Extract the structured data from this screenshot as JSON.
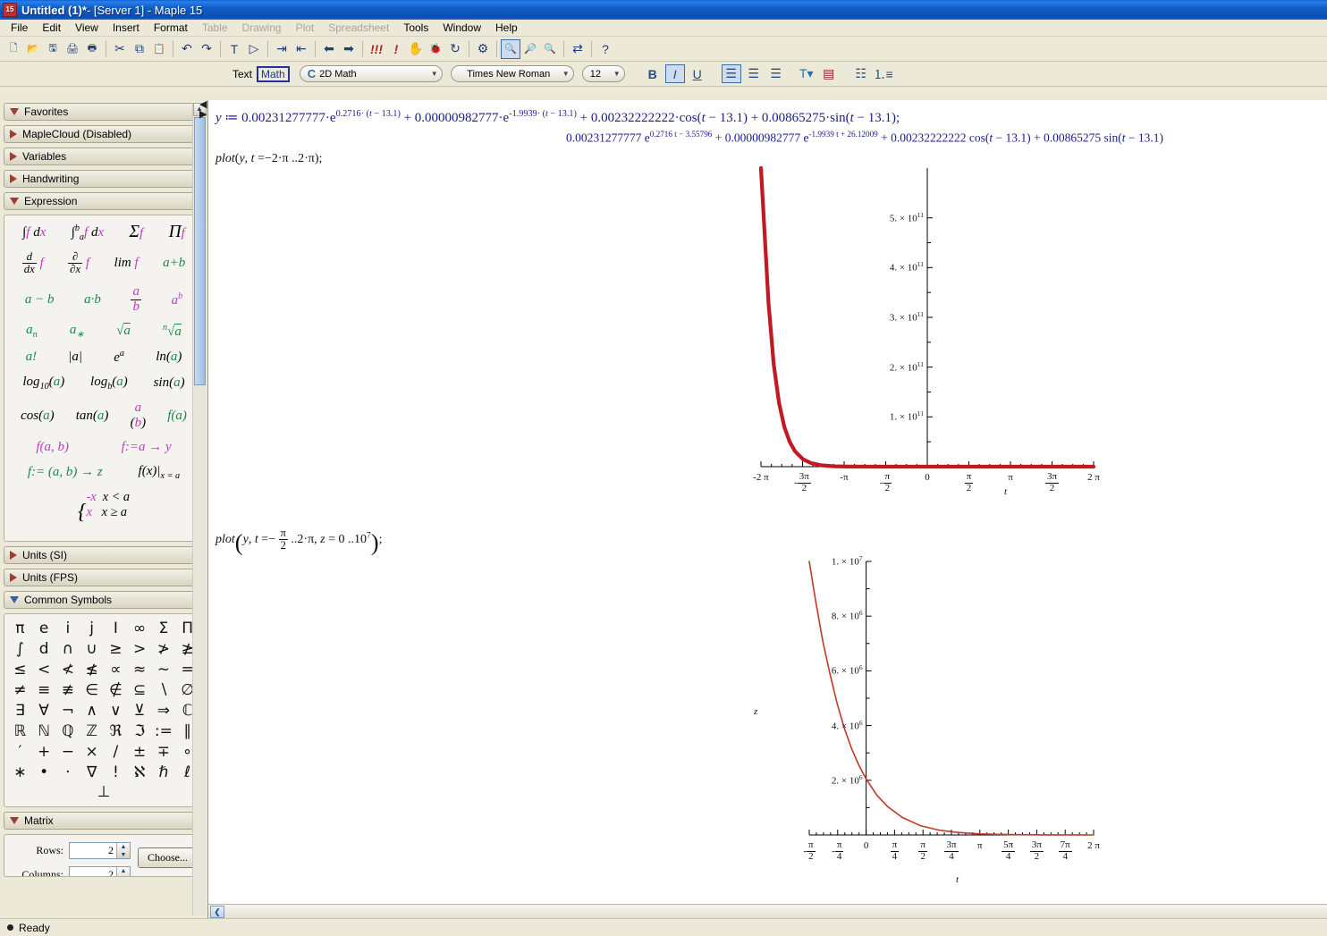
{
  "window": {
    "title_main": "Untitled (1)*",
    "title_suffix": " - [Server 1] - Maple 15",
    "app_icon": "maple-icon"
  },
  "menu": [
    {
      "label": "File",
      "disabled": false
    },
    {
      "label": "Edit",
      "disabled": false
    },
    {
      "label": "View",
      "disabled": false
    },
    {
      "label": "Insert",
      "disabled": false
    },
    {
      "label": "Format",
      "disabled": false
    },
    {
      "label": "Table",
      "disabled": true
    },
    {
      "label": "Drawing",
      "disabled": true
    },
    {
      "label": "Plot",
      "disabled": true
    },
    {
      "label": "Spreadsheet",
      "disabled": true
    },
    {
      "label": "Tools",
      "disabled": false
    },
    {
      "label": "Window",
      "disabled": false
    },
    {
      "label": "Help",
      "disabled": false
    }
  ],
  "toolbar": [
    {
      "name": "new-document-icon",
      "glyph": "🗋"
    },
    {
      "name": "open-document-icon",
      "glyph": "📂"
    },
    {
      "name": "save-icon",
      "glyph": "🖫"
    },
    {
      "name": "print-icon",
      "glyph": "🖨"
    },
    {
      "name": "print-preview-icon",
      "glyph": "🖶"
    },
    {
      "name": "sep",
      "glyph": ""
    },
    {
      "name": "cut-icon",
      "glyph": "✂"
    },
    {
      "name": "copy-icon",
      "glyph": "⧉"
    },
    {
      "name": "paste-icon",
      "glyph": "📋"
    },
    {
      "name": "sep",
      "glyph": ""
    },
    {
      "name": "undo-icon",
      "glyph": "↶"
    },
    {
      "name": "redo-icon",
      "glyph": "↷"
    },
    {
      "name": "sep",
      "glyph": ""
    },
    {
      "name": "text-mode-icon",
      "glyph": "T"
    },
    {
      "name": "math-mode-icon",
      "glyph": "▷"
    },
    {
      "name": "sep",
      "glyph": ""
    },
    {
      "name": "indent-icon",
      "glyph": "⇥"
    },
    {
      "name": "outdent-icon",
      "glyph": "⇤"
    },
    {
      "name": "sep",
      "glyph": ""
    },
    {
      "name": "back-icon",
      "glyph": "⬅"
    },
    {
      "name": "forward-icon",
      "glyph": "➡"
    },
    {
      "name": "sep",
      "glyph": ""
    },
    {
      "name": "execute-all-icon",
      "glyph": "!!!"
    },
    {
      "name": "execute-icon",
      "glyph": "!"
    },
    {
      "name": "stop-icon",
      "glyph": "✋"
    },
    {
      "name": "debug-icon",
      "glyph": "🐞"
    },
    {
      "name": "restart-server-icon",
      "glyph": "↻"
    },
    {
      "name": "sep",
      "glyph": ""
    },
    {
      "name": "options-icon",
      "glyph": "⚙"
    },
    {
      "name": "sep",
      "glyph": ""
    },
    {
      "name": "zoom-fit-icon",
      "glyph": "🔍",
      "active": true
    },
    {
      "name": "zoom-in-icon",
      "glyph": "🔎"
    },
    {
      "name": "zoom-out-icon",
      "glyph": "🔍"
    },
    {
      "name": "sep",
      "glyph": ""
    },
    {
      "name": "toggle-input-icon",
      "glyph": "⇄"
    },
    {
      "name": "sep",
      "glyph": ""
    },
    {
      "name": "help-icon",
      "glyph": "?"
    }
  ],
  "format_bar": {
    "text_label": "Text",
    "math_label": "Math",
    "math_active": true,
    "mode_combo": {
      "icon": "C",
      "value": "2D Math"
    },
    "font_combo": {
      "value": "Times New Roman"
    },
    "size_combo": {
      "value": "12"
    },
    "bold_label": "B",
    "italic_label": "I",
    "underline_label": "U",
    "italic_active": true,
    "align_left_active": true,
    "buttons": [
      "align-left",
      "align-center",
      "align-right",
      "text-color",
      "highlight-color",
      "bullet-list",
      "numbered-list"
    ]
  },
  "palettes": [
    {
      "label": "Favorites",
      "expanded": true,
      "arrow": "down"
    },
    {
      "label": "MapleCloud (Disabled)",
      "expanded": false,
      "arrow": "right"
    },
    {
      "label": "Variables",
      "expanded": false,
      "arrow": "right"
    },
    {
      "label": "Handwriting",
      "expanded": false,
      "arrow": "right"
    },
    {
      "label": "Expression",
      "expanded": true,
      "arrow": "down"
    },
    {
      "label": "Units (SI)",
      "expanded": false,
      "arrow": "right"
    },
    {
      "label": "Units (FPS)",
      "expanded": false,
      "arrow": "right"
    },
    {
      "label": "Common Symbols",
      "expanded": true,
      "arrow": "down-blue"
    },
    {
      "label": "Matrix",
      "expanded": true,
      "arrow": "down"
    }
  ],
  "expression_palette": {
    "rows": [
      [
        "integral-indefinite",
        "integral-definite",
        "sum",
        "product"
      ],
      [
        "derivative",
        "partial-derivative",
        "limit",
        "a-plus-b"
      ],
      [
        "a-minus-b",
        "a-times-b",
        "a-over-b",
        "a-power-b"
      ],
      [
        "a-sub-n",
        "a-sub-star",
        "sqrt-a",
        "nth-root-a"
      ],
      [
        "a-factorial",
        "abs-a",
        "e-power-a",
        "ln-a"
      ],
      [
        "log10-a",
        "logb-a",
        "sin-a"
      ],
      [
        "cos-a",
        "tan-a",
        "binomial",
        "f-of-a"
      ],
      [
        "f-of-a-b",
        "f-assign-a-to-y"
      ],
      [
        "f-assign-ab-to-z",
        "f-of-x-eval-at"
      ],
      [
        "piecewise"
      ]
    ]
  },
  "common_symbols": {
    "rows": [
      [
        "π",
        "e",
        "i",
        "j",
        "I",
        "∞",
        "Σ",
        "Π"
      ],
      [
        "∫",
        "d",
        "∩",
        "∪",
        "≥",
        ">",
        "≯",
        "≱"
      ],
      [
        "≤",
        "<",
        "≮",
        "≰",
        "∝",
        "≈",
        "∼",
        "="
      ],
      [
        "≠",
        "≡",
        "≢",
        "∈",
        "∉",
        "⊆",
        "∖",
        "∅"
      ],
      [
        "∃",
        "∀",
        "¬",
        "∧",
        "∨",
        "⊻",
        "⇒",
        "ℂ"
      ],
      [
        "ℝ",
        "ℕ",
        "ℚ",
        "ℤ",
        "ℜ",
        "ℑ",
        ":=",
        "∥"
      ],
      [
        "′",
        "+",
        "−",
        "×",
        "/",
        "±",
        "∓",
        "∘"
      ],
      [
        "∗",
        "•",
        "·",
        "∇",
        "!",
        "ℵ",
        "ℏ",
        "ℓ"
      ]
    ],
    "last": "⊥"
  },
  "matrix_panel": {
    "rows_label": "Rows:",
    "rows_value": "2",
    "columns_label": "Columns:",
    "columns_value": "2",
    "choose_label": "Choose..."
  },
  "document": {
    "line1": {
      "assign_var": "y",
      "assign_op": ":=",
      "terms": "0.00231277777·e^(0.2716·(t − 13.1)) + 0.00000982777·e^(−1.9939·(t − 13.1)) + 0.00232222222·cos(t − 13.1) + 0.00865275·sin(t − 13.1);"
    },
    "line2_output": "0.00231277777 e^(0.2716 t − 3.55796) + 0.00000982777 e^(−1.9939 t + 26.12009) + 0.00232222222 cos(t − 13.1) + 0.00865275 sin(t − 13.1)",
    "line3": "plot(y, t = −2·π .. 2·π);",
    "line4": "plot(y, t = −π/2 .. 2·π, z = 0 .. 10^7);",
    "coef1": "0.00231277777",
    "coef2": "0.00000982777",
    "coef3": "0.00232222222",
    "coef4": "0.00865275",
    "exp1": "0.2716",
    "exp2": "-1.9939",
    "shift": "13.1",
    "exp1_out": "0.2716 t − 3.55796",
    "exp2_out": "-1.9939 t + 26.12009"
  },
  "chart_data": [
    {
      "type": "line",
      "name": "plot-1-y-vs-t",
      "title": "",
      "xlabel": "t",
      "ylabel": "",
      "curve_color": "#C01A22",
      "xlim": [
        -6.2832,
        6.2832
      ],
      "ylim": [
        0,
        600000000000
      ],
      "x_ticks": [
        {
          "value": -6.2832,
          "label": "-2 π"
        },
        {
          "value": -4.7124,
          "label": "- 3π/2"
        },
        {
          "value": -3.1416,
          "label": "-π"
        },
        {
          "value": -1.5708,
          "label": "- π/2"
        },
        {
          "value": 0,
          "label": "0"
        },
        {
          "value": 1.5708,
          "label": "π/2"
        },
        {
          "value": 3.1416,
          "label": "π"
        },
        {
          "value": 4.7124,
          "label": "3π/2"
        },
        {
          "value": 6.2832,
          "label": "2 π"
        }
      ],
      "y_ticks": [
        {
          "value": 100000000000,
          "label": "1. × 10",
          "exp": "11"
        },
        {
          "value": 200000000000,
          "label": "2. × 10",
          "exp": "11"
        },
        {
          "value": 300000000000,
          "label": "3. × 10",
          "exp": "11"
        },
        {
          "value": 400000000000,
          "label": "4. × 10",
          "exp": "11"
        },
        {
          "value": 500000000000,
          "label": "5. × 10",
          "exp": "11"
        }
      ],
      "points": [
        {
          "x": -6.2832,
          "y": 600000000000
        },
        {
          "x": -6.0,
          "y": 330000000000
        },
        {
          "x": -5.8,
          "y": 205000000000
        },
        {
          "x": -5.6,
          "y": 128000000000
        },
        {
          "x": -5.4,
          "y": 80000000000
        },
        {
          "x": -5.2,
          "y": 50000000000
        },
        {
          "x": -5.0,
          "y": 31000000000
        },
        {
          "x": -4.7,
          "y": 15000000000
        },
        {
          "x": -4.4,
          "y": 7300000000
        },
        {
          "x": -4.0,
          "y": 2700000000
        },
        {
          "x": -3.5,
          "y": 750000000
        },
        {
          "x": -3.0,
          "y": 210000000
        },
        {
          "x": -2.0,
          "y": 16000000
        },
        {
          "x": 0,
          "y": 60000
        },
        {
          "x": 3.1416,
          "y": 300
        },
        {
          "x": 6.2832,
          "y": 10
        }
      ]
    },
    {
      "type": "line",
      "name": "plot-2-z-vs-t",
      "title": "",
      "xlabel": "t",
      "ylabel": "z",
      "curve_color": "#C0392B",
      "xlim": [
        -1.5708,
        6.2832
      ],
      "ylim": [
        0,
        10000000
      ],
      "x_ticks": [
        {
          "value": -1.5708,
          "label": "- π/2"
        },
        {
          "value": -0.7854,
          "label": "- π/4"
        },
        {
          "value": 0,
          "label": "0"
        },
        {
          "value": 0.7854,
          "label": "π/4"
        },
        {
          "value": 1.5708,
          "label": "π/2"
        },
        {
          "value": 2.3562,
          "label": "3π/4"
        },
        {
          "value": 3.1416,
          "label": "π"
        },
        {
          "value": 3.927,
          "label": "5π/4"
        },
        {
          "value": 4.7124,
          "label": "3π/2"
        },
        {
          "value": 5.4978,
          "label": "7π/4"
        },
        {
          "value": 6.2832,
          "label": "2 π"
        }
      ],
      "y_ticks": [
        {
          "value": 2000000,
          "label": "2. × 10",
          "exp": "6"
        },
        {
          "value": 4000000,
          "label": "4. × 10",
          "exp": "6"
        },
        {
          "value": 6000000,
          "label": "6. × 10",
          "exp": "6"
        },
        {
          "value": 8000000,
          "label": "8. × 10",
          "exp": "6"
        },
        {
          "value": 10000000,
          "label": "1. × 10",
          "exp": "7"
        }
      ],
      "points": [
        {
          "x": -1.5708,
          "y": 10000000
        },
        {
          "x": -1.4,
          "y": 8600000
        },
        {
          "x": -1.2,
          "y": 7100000
        },
        {
          "x": -1.0,
          "y": 5900000
        },
        {
          "x": -0.8,
          "y": 4800000
        },
        {
          "x": -0.6,
          "y": 3900000
        },
        {
          "x": -0.4,
          "y": 3150000
        },
        {
          "x": -0.2,
          "y": 2550000
        },
        {
          "x": 0.0,
          "y": 2050000
        },
        {
          "x": 0.3,
          "y": 1450000
        },
        {
          "x": 0.6,
          "y": 1030000
        },
        {
          "x": 1.0,
          "y": 640000
        },
        {
          "x": 1.5,
          "y": 340000
        },
        {
          "x": 2.0,
          "y": 180000
        },
        {
          "x": 2.5,
          "y": 95000
        },
        {
          "x": 3.1416,
          "y": 40000
        },
        {
          "x": 4.0,
          "y": 12000
        },
        {
          "x": 5.0,
          "y": 3000
        },
        {
          "x": 6.2832,
          "y": 500
        }
      ]
    }
  ],
  "scrollbars": {
    "palette_up": "▲",
    "palette_down": "▼",
    "doc_left": "❮",
    "collapse": "◀"
  },
  "status": {
    "text": "Ready"
  }
}
